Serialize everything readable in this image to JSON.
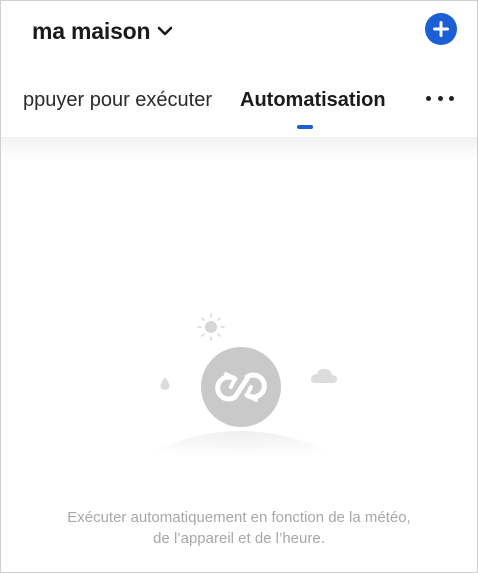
{
  "header": {
    "home_name": "ma maison",
    "chevron_icon": "chevron-down-icon",
    "add_icon": "plus-circle-icon"
  },
  "tabs": {
    "items": [
      {
        "label": "ppuyer pour exécuter",
        "active": false
      },
      {
        "label": "Automatisation",
        "active": true
      }
    ],
    "more_icon": "more-horizontal-icon"
  },
  "empty_state": {
    "line1": "Exécuter automatiquement en fonction de la météo,",
    "line2": "de l’appareil et de l’heure.",
    "icons": [
      "sun-icon",
      "raindrop-icon",
      "cloud-icon",
      "automation-loop-icon"
    ]
  },
  "colors": {
    "accent": "#1a5fd6",
    "text_primary": "#1b1b1b",
    "text_muted": "#a8a8a8",
    "illustration_gray": "#c9c9c9"
  }
}
